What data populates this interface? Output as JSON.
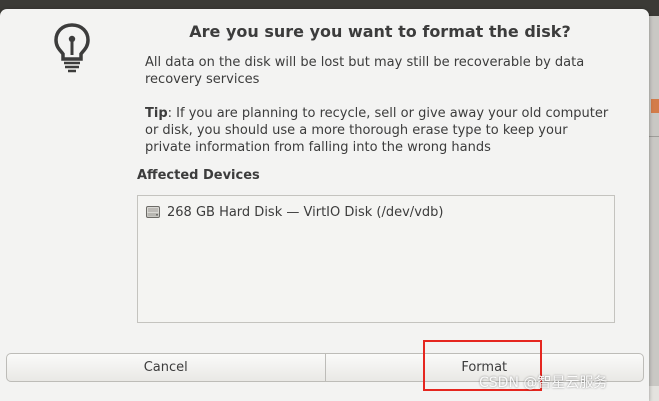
{
  "dialog": {
    "title": "Are you sure you want to format the disk?",
    "message": "All data on the disk will be lost but may still be recoverable by data recovery services",
    "tip": {
      "label": "Tip",
      "text": ": If you are planning to recycle, sell or give away your old computer or disk, you should use a more thorough erase type to keep your private information from falling into the wrong hands"
    },
    "icon": "lightbulb-icon",
    "affected_devices": {
      "label": "Affected Devices",
      "items": [
        {
          "icon": "hard-disk-icon",
          "label": "268 GB Hard Disk — VirtIO Disk (/dev/vdb)"
        }
      ]
    },
    "buttons": {
      "cancel": "Cancel",
      "format": "Format"
    }
  },
  "annotation": {
    "color": "#e5261f"
  },
  "watermark": "CSDN @智星云服务"
}
